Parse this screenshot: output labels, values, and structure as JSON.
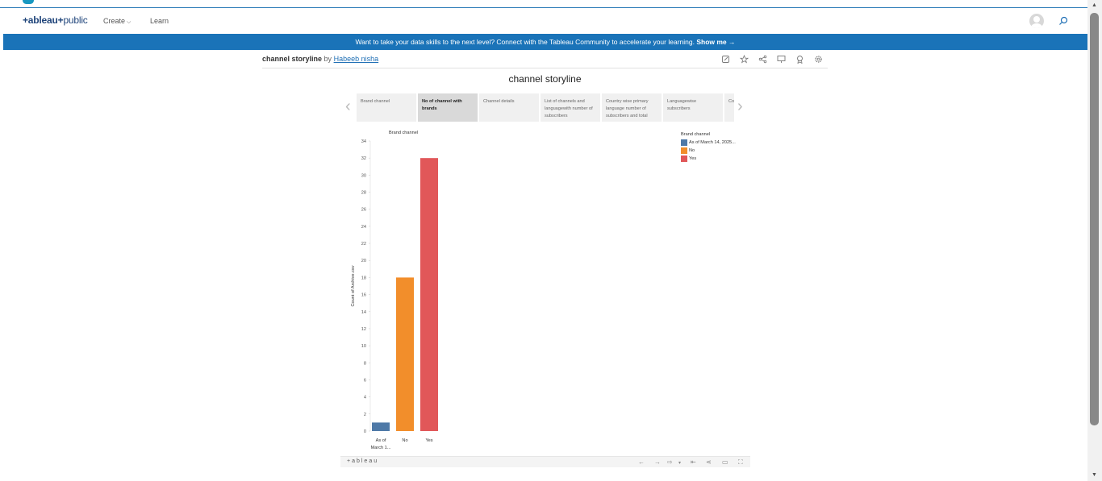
{
  "salesforce": {
    "label": "salesforce"
  },
  "nav": {
    "logo_prefix": "+ableau",
    "logo_mark": "+",
    "logo_suffix": "public",
    "create_label": "Create",
    "learn_label": "Learn"
  },
  "banner": {
    "text": "Want to take your data skills to the next level? Connect with the Tableau Community to accelerate your learning.",
    "link": "Show me →"
  },
  "viz": {
    "title": "channel storyline",
    "by": "by",
    "author": "Habeeb nisha"
  },
  "story": {
    "title": "channel storyline",
    "points": [
      {
        "label": "Brand channel"
      },
      {
        "label": "No of channel with brands"
      },
      {
        "label": "Channel details"
      },
      {
        "label": "List of channels and languagewith number of subscribers"
      },
      {
        "label": "Country wise primary language number of subscribers and total"
      },
      {
        "label": "Languagewise subscribers"
      },
      {
        "label": "Co su"
      }
    ],
    "active_index": 1
  },
  "chart_data": {
    "type": "bar",
    "sheet_title": "Brand channel",
    "ylabel": "Count of Archive.csv",
    "xlabel": "",
    "ylim": [
      0,
      34
    ],
    "yticks": [
      0,
      2,
      4,
      6,
      8,
      10,
      12,
      14,
      16,
      18,
      20,
      22,
      24,
      26,
      28,
      30,
      32,
      34
    ],
    "categories": [
      "As of March 1...",
      "No",
      "Yes"
    ],
    "values": [
      1,
      18,
      32
    ],
    "colors": [
      "#4e79a7",
      "#f28e2b",
      "#e15759"
    ],
    "legend": {
      "title": "Brand channel",
      "entries": [
        "As of March 14, 2025...",
        "No",
        "Yes"
      ],
      "placement": "top-right"
    }
  },
  "footer": {
    "logo": "+ableau"
  }
}
